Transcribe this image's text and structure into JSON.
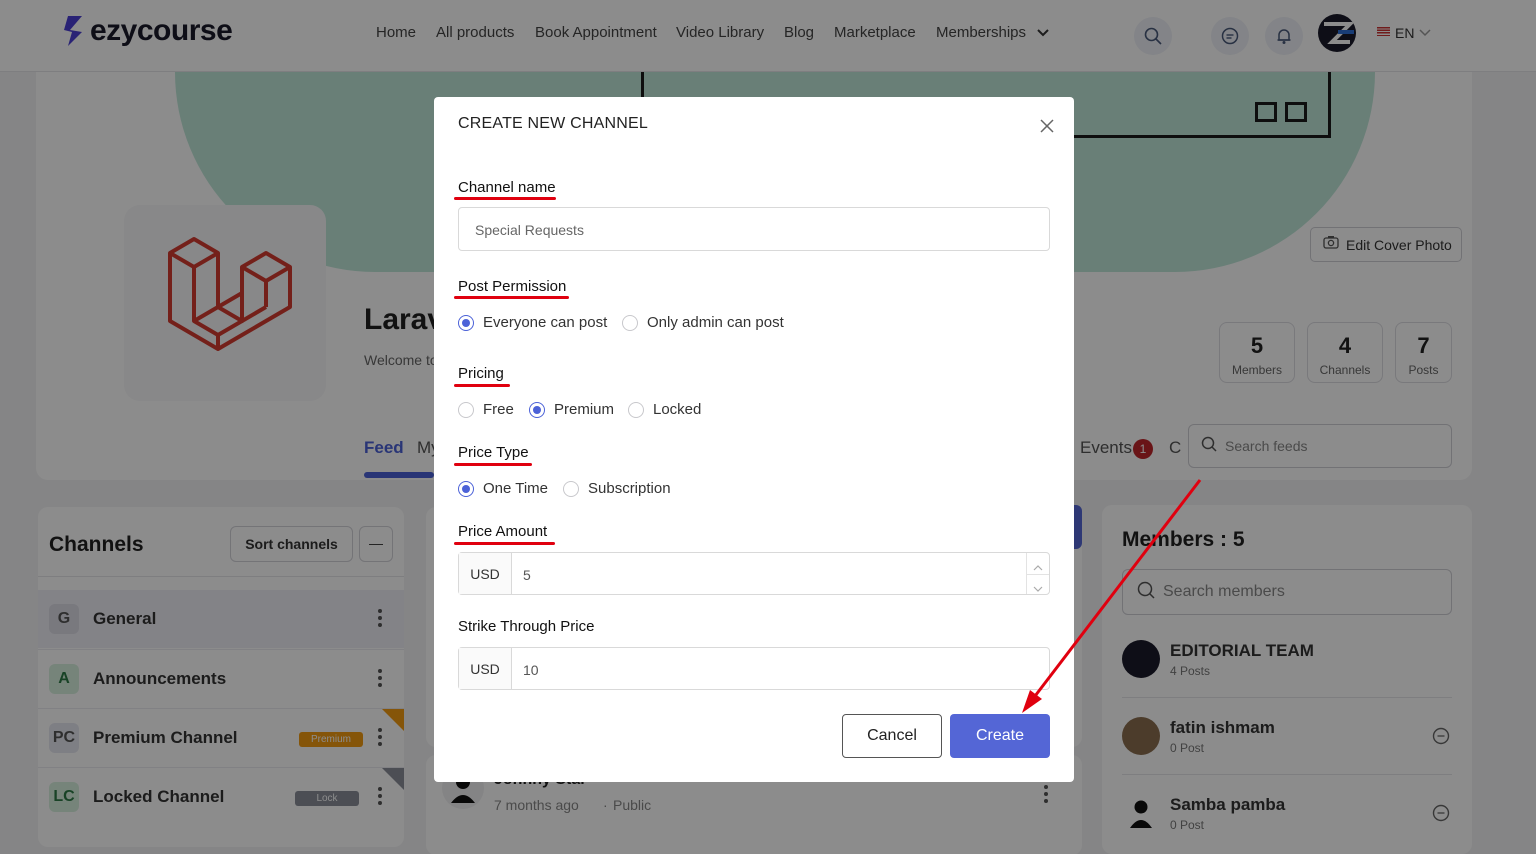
{
  "header": {
    "logo_text": "ezycourse",
    "nav": [
      "Home",
      "All products",
      "Book Appointment",
      "Video Library",
      "Blog",
      "Marketplace",
      "Memberships"
    ],
    "lang": "EN"
  },
  "community": {
    "name_partial": "Larav",
    "welcome_partial": "Welcome to",
    "edit_cover": "Edit Cover Photo",
    "stats": [
      {
        "value": "5",
        "label": "Members"
      },
      {
        "value": "4",
        "label": "Channels"
      },
      {
        "value": "7",
        "label": "Posts"
      }
    ],
    "tabs": {
      "feed": "Feed",
      "my_partial": "My",
      "events": "Events",
      "events_badge": "1",
      "c_partial": "C"
    },
    "search_feeds_placeholder": "Search feeds"
  },
  "channels": {
    "title": "Channels",
    "sort_label": "Sort channels",
    "collapse_symbol": "—",
    "items": [
      {
        "badge": "G",
        "name": "General",
        "badge_bg": "#e9e9ef",
        "badge_fg": "#555"
      },
      {
        "badge": "A",
        "name": "Announcements",
        "badge_bg": "#d8f0df",
        "badge_fg": "#2d7a45"
      },
      {
        "badge": "PC",
        "name": "Premium Channel",
        "badge_bg": "#e6e7f0",
        "badge_fg": "#555",
        "tag": "Premium"
      },
      {
        "badge": "LC",
        "name": "Locked Channel",
        "badge_bg": "#d8f0df",
        "badge_fg": "#2d7a45",
        "tag": "Lock"
      }
    ]
  },
  "post": {
    "author_partial": "Johnny Stal",
    "meta": "7 months ago",
    "visibility": "Public"
  },
  "members": {
    "title": "Members : 5",
    "search_placeholder": "Search members",
    "list": [
      {
        "name": "EDITORIAL TEAM",
        "posts": "4 Posts"
      },
      {
        "name": "fatin ishmam",
        "posts": "0 Post"
      },
      {
        "name": "Samba pamba",
        "posts": "0 Post"
      }
    ]
  },
  "modal": {
    "title": "CREATE NEW CHANNEL",
    "channel_name_label": "Channel name",
    "channel_name_placeholder": "Special Requests",
    "post_permission_label": "Post Permission",
    "post_permission_options": [
      "Everyone can post",
      "Only admin can post"
    ],
    "post_permission_selected": "Everyone can post",
    "pricing_label": "Pricing",
    "pricing_options": [
      "Free",
      "Premium",
      "Locked"
    ],
    "pricing_selected": "Premium",
    "price_type_label": "Price Type",
    "price_type_options": [
      "One Time",
      "Subscription"
    ],
    "price_type_selected": "One Time",
    "price_amount_label": "Price Amount",
    "currency": "USD",
    "price_amount_value": "5",
    "strike_label": "Strike Through Price",
    "strike_value": "10",
    "cancel_label": "Cancel",
    "create_label": "Create"
  },
  "colors": {
    "primary": "#5466d6",
    "annotation": "#e0000f",
    "premium_tag": "#f39c12",
    "lock_tag": "#8a8f9a"
  }
}
